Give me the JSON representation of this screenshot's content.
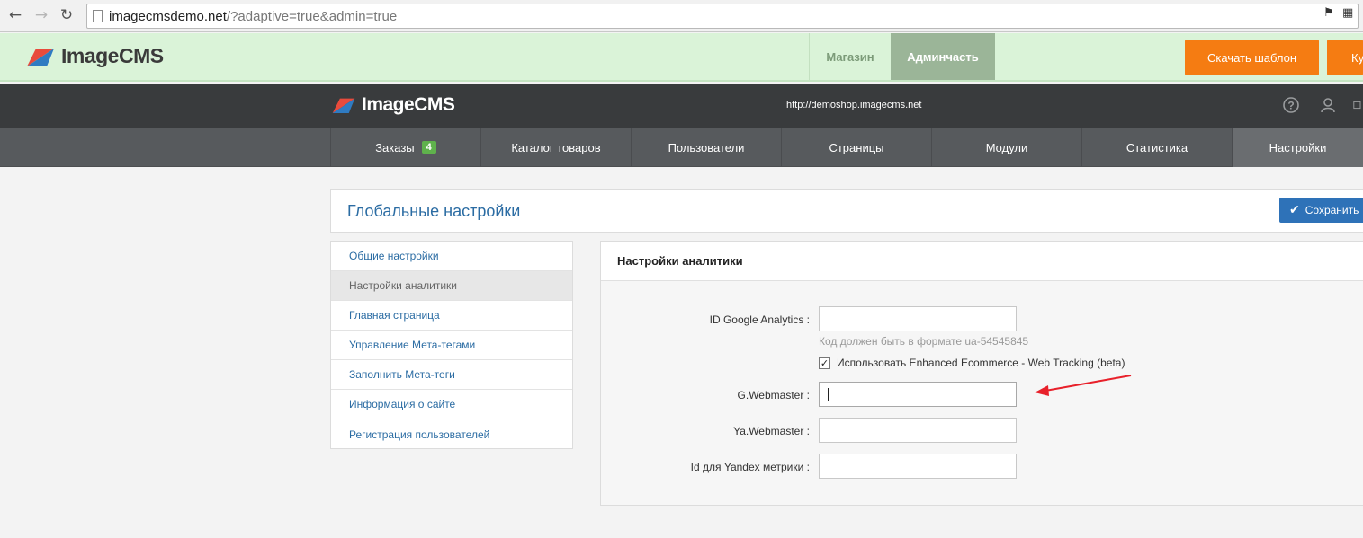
{
  "browser": {
    "url_host": "imagecmsdemo.net",
    "url_rest": "/?adaptive=true&admin=true",
    "icons": [
      "back-arrow-icon",
      "forward-arrow-icon",
      "reload-icon",
      "page-icon",
      "bookmark-icon",
      "extension-icon"
    ]
  },
  "site": {
    "logo_text": "ImageCMS",
    "tab_shop": "Магазин",
    "tab_admin": "Админчасть",
    "btn_download": "Скачать шаблон",
    "btn_buy": "Ку"
  },
  "admin": {
    "logo_text": "ImageCMS",
    "site_url": "http://demoshop.imagecms.net",
    "icons": [
      "help-icon",
      "user-icon",
      "logout-icon"
    ]
  },
  "menu": [
    {
      "label": "Заказы",
      "badge": "4"
    },
    {
      "label": "Каталог товаров"
    },
    {
      "label": "Пользователи"
    },
    {
      "label": "Страницы"
    },
    {
      "label": "Модули"
    },
    {
      "label": "Статистика"
    },
    {
      "label": "Настройки",
      "active": true
    }
  ],
  "page": {
    "title": "Глобальные настройки",
    "save_label": "Сохранить"
  },
  "leftnav": [
    {
      "label": "Общие настройки"
    },
    {
      "label": "Настройки аналитики",
      "active": true
    },
    {
      "label": "Главная страница"
    },
    {
      "label": "Управление Мета-тегами"
    },
    {
      "label": "Заполнить Мета-теги"
    },
    {
      "label": "Информация о сайте"
    },
    {
      "label": "Регистрация пользователей"
    }
  ],
  "panel": {
    "title": "Настройки аналитики",
    "ga_label": "ID Google Analytics :",
    "ga_value": "",
    "ga_hint": "Код должен быть в формате ua-54545845",
    "ecommerce_label": "Использовать Enhanced Ecommerce - Web Tracking (beta)",
    "ecommerce_checked": true,
    "gwm_label": "G.Webmaster :",
    "gwm_value": "",
    "yawm_label": "Ya.Webmaster :",
    "yawm_value": "",
    "yametrika_label": "Id для Yandex метрики :",
    "yametrika_value": ""
  },
  "colors": {
    "accent_blue": "#2b6ca3",
    "orange": "#f57c12",
    "badge_green": "#5fb24c",
    "annotation_arrow": "#e8202a"
  }
}
